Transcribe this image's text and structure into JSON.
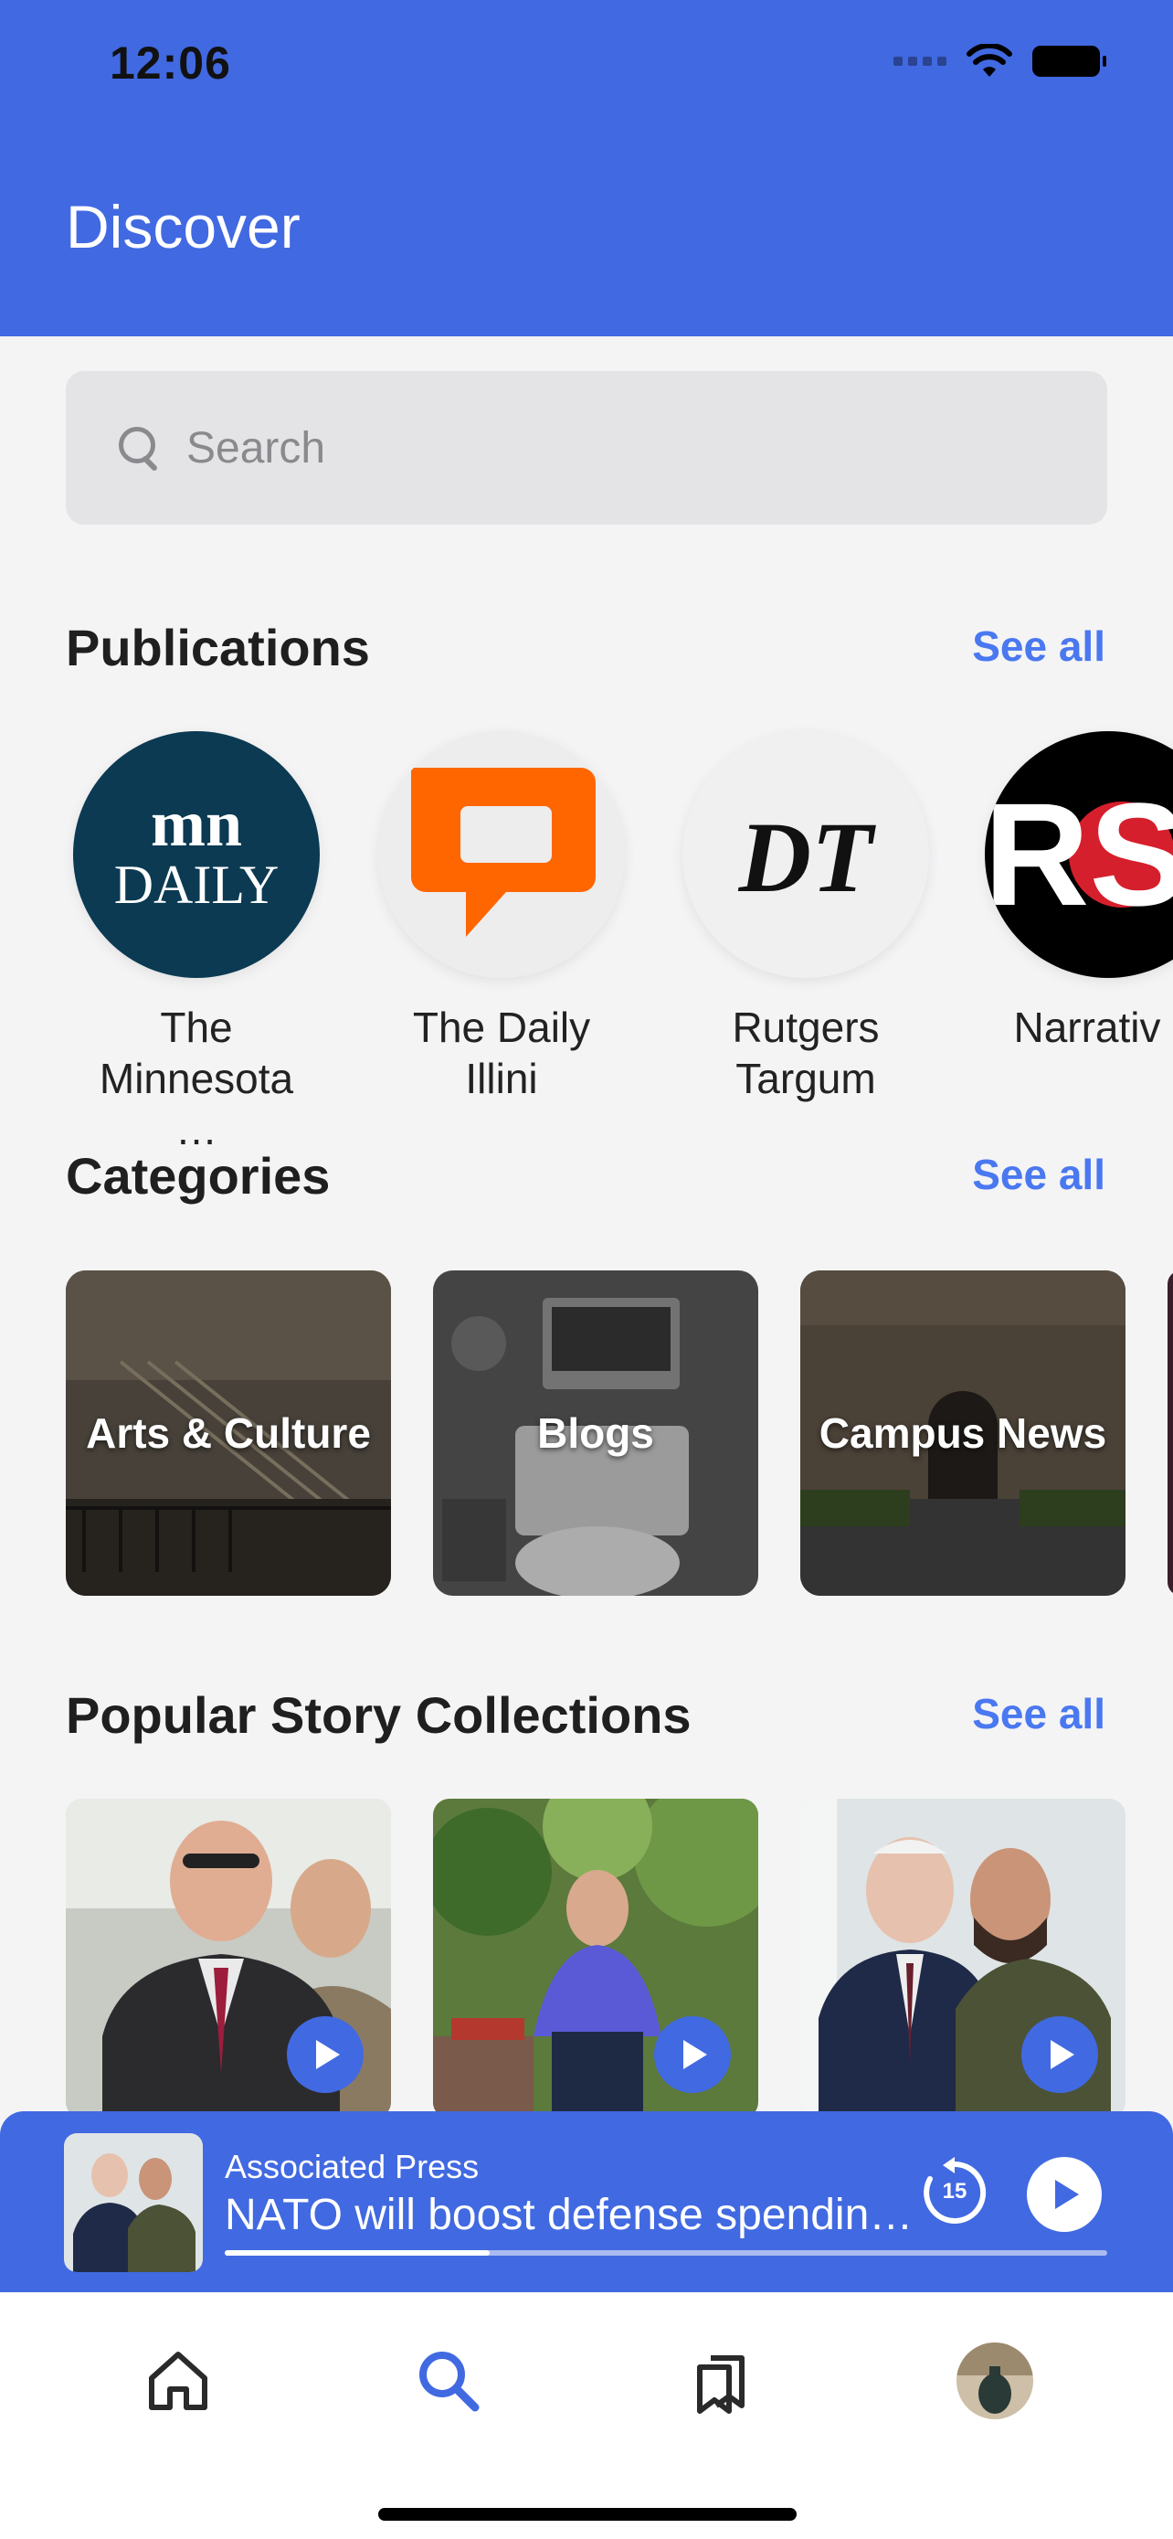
{
  "status_bar": {
    "time": "12:06"
  },
  "header": {
    "title": "Discover"
  },
  "search": {
    "placeholder": "Search"
  },
  "publications": {
    "title": "Publications",
    "see_all": "See all",
    "items": [
      {
        "name": "The Minnesota …",
        "logo_text_top": "mn",
        "logo_text_bottom": "DAILY"
      },
      {
        "name": "The Daily Illini"
      },
      {
        "name": "Rutgers Targum",
        "logo_text": "DT"
      },
      {
        "name": "Narrativ D",
        "logo_text": "RS"
      }
    ]
  },
  "categories": {
    "title": "Categories",
    "see_all": "See all",
    "items": [
      {
        "label": "Arts & Culture"
      },
      {
        "label": "Blogs"
      },
      {
        "label": "Campus News"
      }
    ]
  },
  "collections": {
    "title": "Popular Story Collections",
    "see_all": "See all",
    "items": [
      {
        "icon": "play-icon"
      },
      {
        "icon": "play-icon"
      },
      {
        "icon": "play-icon"
      }
    ]
  },
  "player": {
    "source": "Associated Press",
    "title": "NATO will boost defense spendin…",
    "skip_seconds": "15",
    "progress": 0.3
  },
  "tabbar": {
    "items": [
      {
        "name": "home",
        "icon": "home-icon",
        "active": false
      },
      {
        "name": "search",
        "icon": "search-icon",
        "active": true
      },
      {
        "name": "library",
        "icon": "bookmarks-icon",
        "active": false
      },
      {
        "name": "profile",
        "icon": "avatar",
        "active": false
      }
    ]
  },
  "colors": {
    "accent": "#4169e1",
    "link": "#4a78f0",
    "background": "#f4f4f5"
  }
}
